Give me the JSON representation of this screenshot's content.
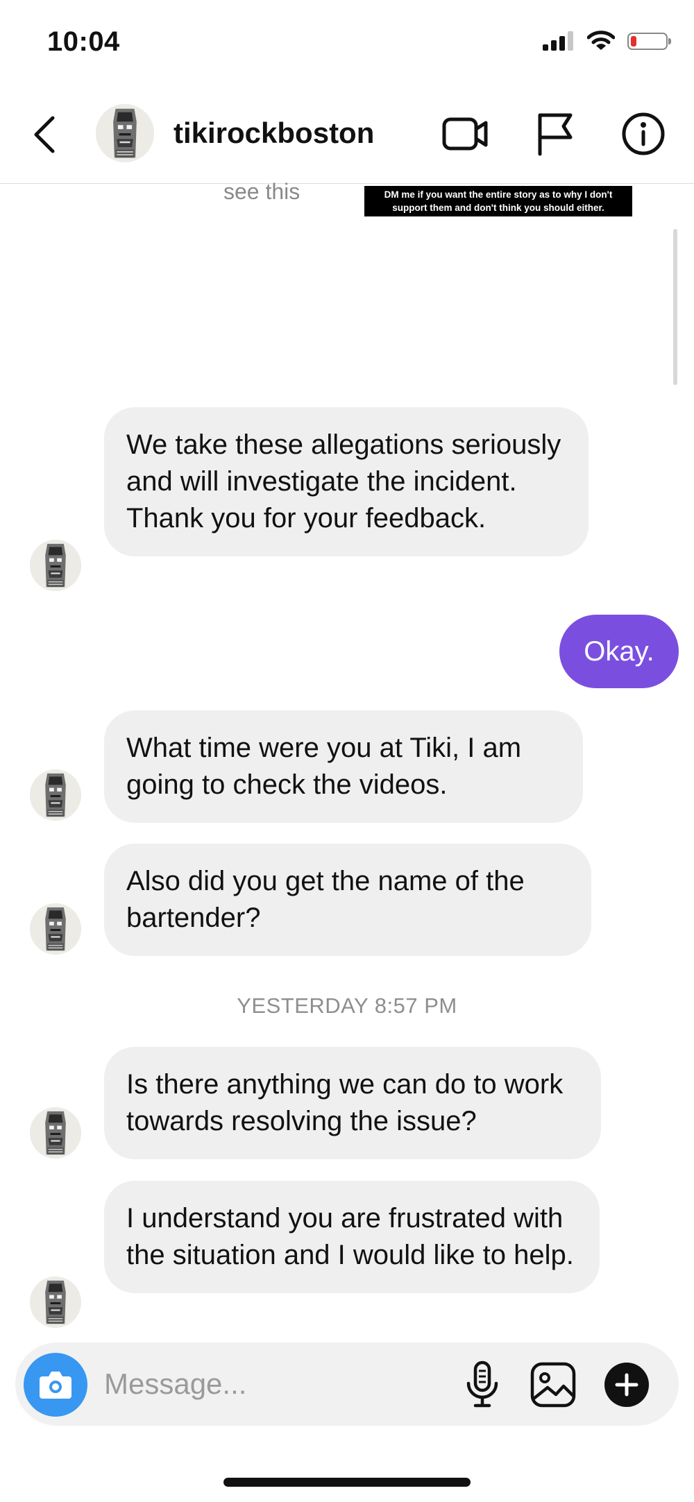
{
  "status_bar": {
    "time": "10:04",
    "icons": [
      "signal-icon",
      "wifi-icon",
      "battery-icon"
    ],
    "battery_color": "#e5302d"
  },
  "header": {
    "username": "tikirockboston",
    "icons": [
      "back-icon",
      "video-call-icon",
      "flag-icon",
      "info-icon"
    ]
  },
  "story_reply": {
    "partial_text": "see this",
    "caption": "DM me if you want the entire story as to why I don't support them and don't think you should either."
  },
  "messages": [
    {
      "from": "them",
      "text": "We take these allegations seriously and will investigate the incident.  Thank you for your feedback."
    },
    {
      "from": "me",
      "text": "Okay."
    },
    {
      "from": "them",
      "text": "What time were you at Tiki, I am going to check the videos."
    },
    {
      "from": "them",
      "text": "Also did you get the name of the bartender?"
    },
    {
      "from": "them",
      "text": "Is there anything we can do to work towards resolving the issue?"
    },
    {
      "from": "them",
      "text": "I understand you are frustrated with the situation and I would like to help."
    }
  ],
  "timestamp": "YESTERDAY 8:57 PM",
  "composer": {
    "placeholder": "Message...",
    "icons": [
      "camera-icon",
      "microphone-icon",
      "gallery-icon",
      "add-icon"
    ]
  },
  "colors": {
    "outgoing_bubble": "#7a4fe0",
    "incoming_bubble": "#efefef",
    "camera_button": "#3897f0"
  }
}
